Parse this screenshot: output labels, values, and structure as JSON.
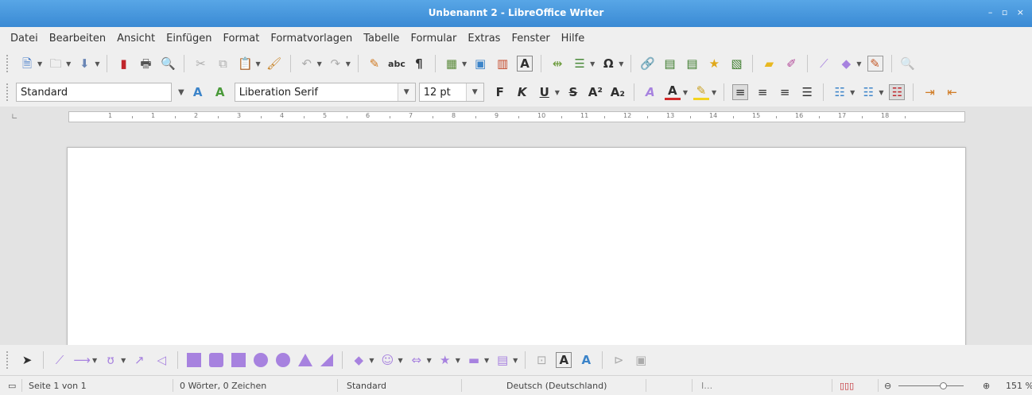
{
  "window": {
    "title": "Unbenannt 2 - LibreOffice Writer",
    "controls": "– ▫ ×"
  },
  "menu": [
    "Datei",
    "Bearbeiten",
    "Ansicht",
    "Einfügen",
    "Format",
    "Formatvorlagen",
    "Tabelle",
    "Formular",
    "Extras",
    "Fenster",
    "Hilfe"
  ],
  "formatting": {
    "paragraph_style": "Standard",
    "font_name": "Liberation Serif",
    "font_size": "12 pt",
    "bold_label": "F",
    "italic_label": "K",
    "underline_label": "U"
  },
  "ruler": {
    "numbers": [
      "1",
      "1",
      "2",
      "3",
      "4",
      "5",
      "6",
      "7",
      "8",
      "9",
      "10",
      "11",
      "12",
      "13",
      "14",
      "15",
      "16",
      "17",
      "18"
    ]
  },
  "status": {
    "page": "Seite 1 von 1",
    "words": "0 Wörter, 0 Zeichen",
    "page_style": "Standard",
    "language": "Deutsch (Deutschland)",
    "insert_mode": "I…",
    "zoom": "151 %"
  },
  "colors": {
    "title_bar": "#3a8ad4",
    "shape_fill": "#a782df",
    "font_color": "#d22a2a",
    "highlight": "#f3d320"
  }
}
